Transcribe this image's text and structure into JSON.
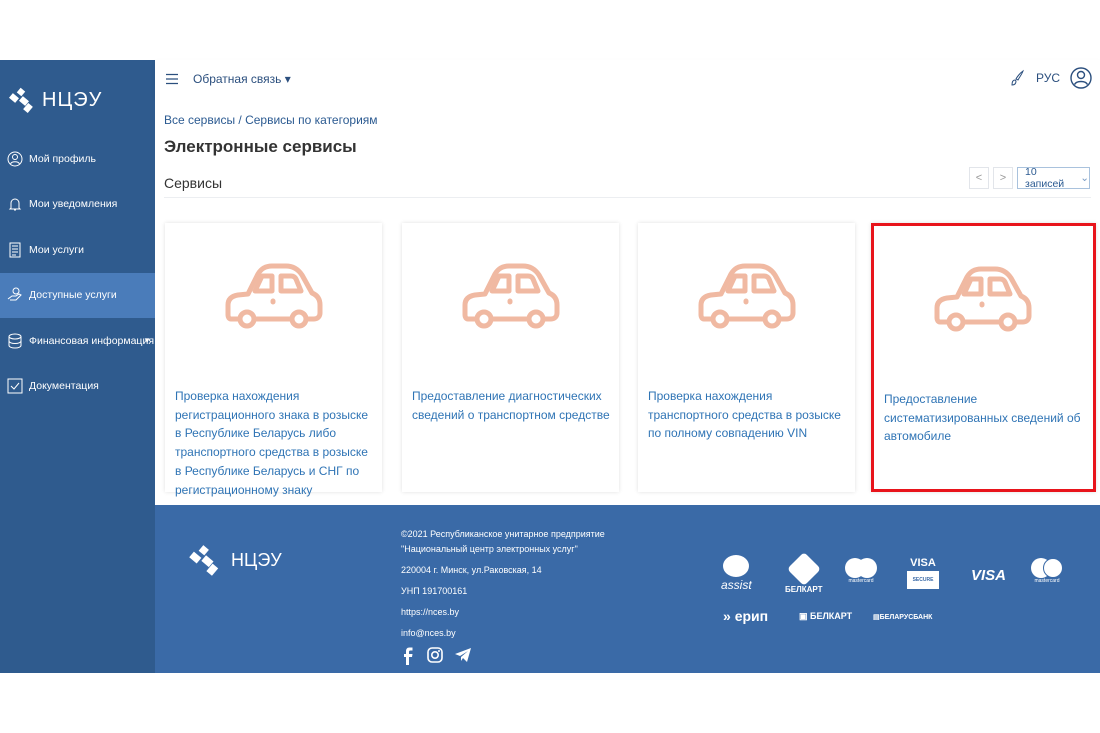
{
  "brand": {
    "name": "НЦЭУ"
  },
  "sidebar": {
    "items": [
      {
        "label": "Мой профиль",
        "icon": "user-circle-icon"
      },
      {
        "label": "Мои уведомления",
        "icon": "bell-icon"
      },
      {
        "label": "Мои услуги",
        "icon": "document-list-icon"
      },
      {
        "label": "Доступные услуги",
        "icon": "hand-service-icon",
        "active": true
      },
      {
        "label": "Финансовая информация",
        "icon": "database-icon",
        "caret": "▼"
      },
      {
        "label": "Документация",
        "icon": "checkbox-icon"
      }
    ]
  },
  "header": {
    "feedback": "Обратная связь",
    "lang": "РУС"
  },
  "main": {
    "breadcrumb": [
      "Все сервисы",
      "Сервисы по категориям"
    ],
    "breadcrumb_sep": "/",
    "title": "Электронные сервисы",
    "subtitle": "Сервисы",
    "pager": {
      "prev": "<",
      "next": ">",
      "page_size": "10 записей"
    },
    "cards": [
      {
        "text": "Проверка нахождения регистрационного знака в розыске в Республике Беларусь либо транспортного средства в розыске в Республике Беларусь и СНГ по регистрационному знаку"
      },
      {
        "text": "Предоставление диагностических сведений о транспортном средстве"
      },
      {
        "text": "Проверка нахождения транспортного средства в розыске по полному совпадению VIN"
      },
      {
        "text": "Предоставление систематизированных сведений об автомобиле"
      }
    ]
  },
  "footer": {
    "lines": [
      "©2021 Республиканское унитарное предприятие",
      "\"Национальный центр электронных услуг\"",
      "220004 г. Минск, ул.Раковская, 14",
      "УНП 191700161",
      "https://nces.by",
      "info@nces.by"
    ],
    "payments": [
      "assist",
      "БЕЛКАРТ",
      "mastercard",
      "VISA",
      "SECURE",
      "VISA",
      "mastercard",
      "ерип",
      "БЕЛКАРТ",
      "БЕЛАРУСБАНК"
    ]
  },
  "colors": {
    "sidebar": "#2f5b8e",
    "active": "#4a7cba",
    "footer": "#3a6aa7",
    "car": "#f0b9a2",
    "highlight": "#e8141b"
  }
}
